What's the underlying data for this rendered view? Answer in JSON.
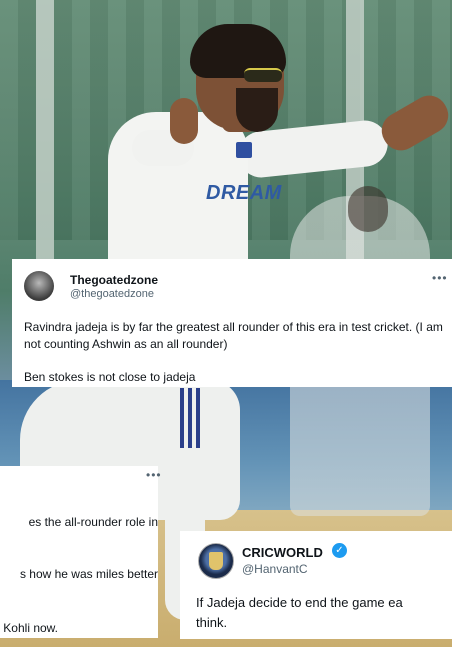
{
  "photo": {
    "jersey_text": "DREAM"
  },
  "tweet1": {
    "display_name": "Thegoatedzone",
    "handle": "@thegoatedzone",
    "more_icon": "more-horizontal-icon",
    "text_line1": "Ravindra jadeja is by far the greatest all rounder of this era in test cricket. (I am not counting Ashwin as an all rounder)",
    "text_line2": "Ben stokes is not close to jadeja"
  },
  "tweet2": {
    "more_icon": "more-horizontal-icon",
    "line1": "es the all-rounder role in",
    "line2": "s how he was miles better",
    "line3": "Kohli now."
  },
  "tweet3": {
    "display_name": "CRICWORLD",
    "verified_icon": "verified-badge-icon",
    "handle": "@HanvantC",
    "text_line1": "If Jadeja decide to end the game ea",
    "text_line2": "think."
  },
  "colors": {
    "verified_blue": "#1d9bf0",
    "handle_gray": "#536471",
    "text_dark": "#0f1419"
  }
}
